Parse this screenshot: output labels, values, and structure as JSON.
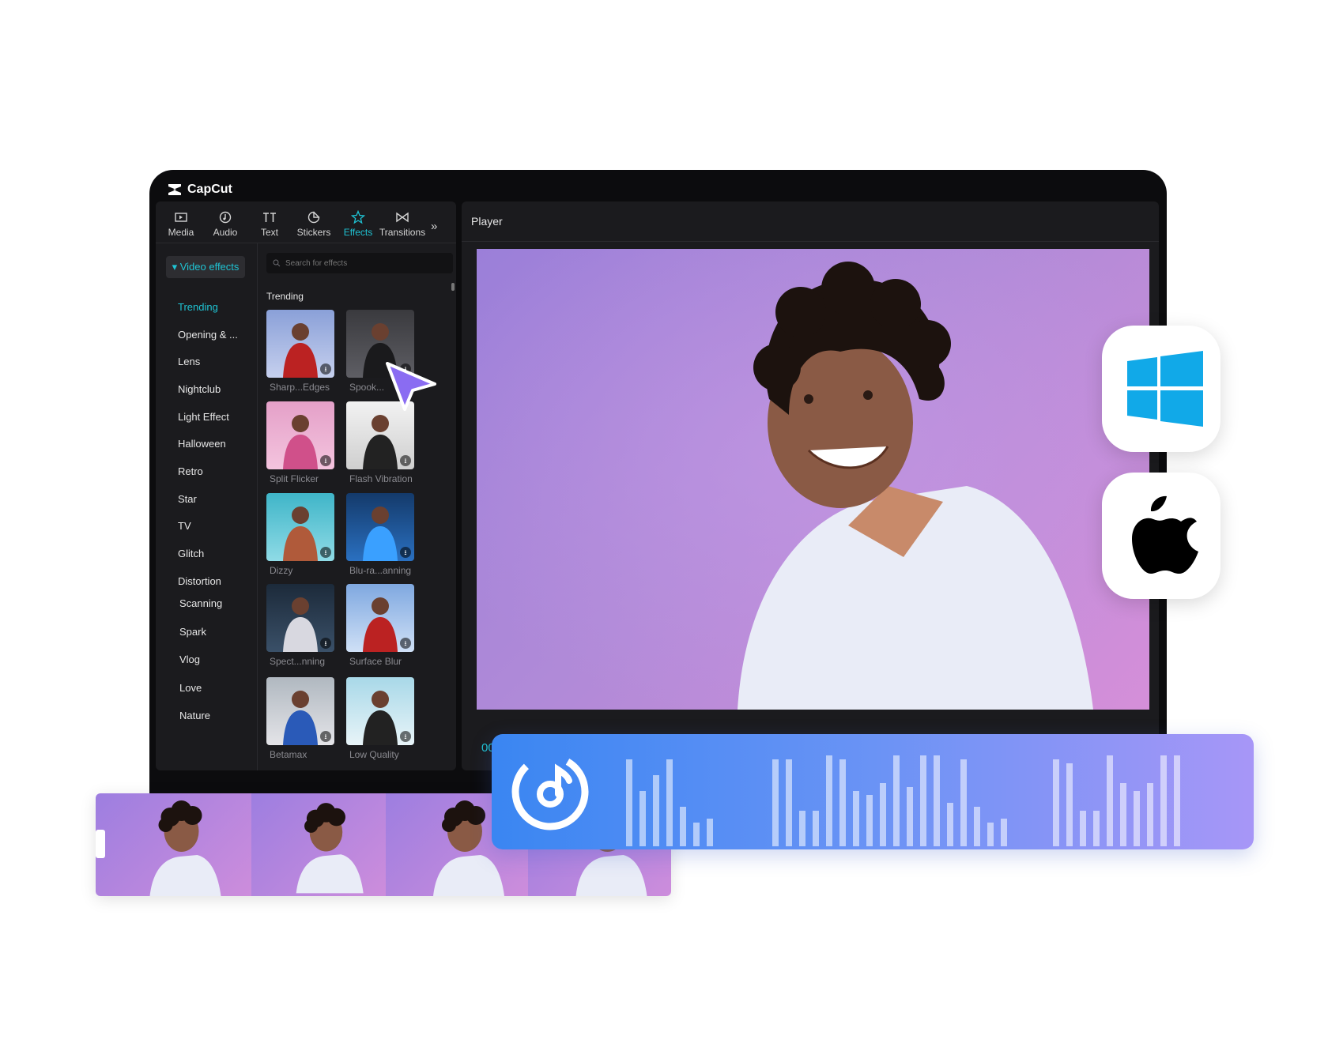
{
  "app": {
    "brand": "CapCut"
  },
  "toolbar": {
    "tabs": [
      {
        "label": "Media",
        "icon": "media-icon"
      },
      {
        "label": "Audio",
        "icon": "audio-icon"
      },
      {
        "label": "Text",
        "icon": "text-icon"
      },
      {
        "label": "Stickers",
        "icon": "stickers-icon"
      },
      {
        "label": "Effects",
        "icon": "effects-icon",
        "active": true
      },
      {
        "label": "Transitions",
        "icon": "transitions-icon"
      }
    ],
    "more": "»"
  },
  "effects_panel": {
    "section": "▾ Video effects",
    "categories": [
      "Trending",
      "Opening & ...",
      "Lens",
      "Nightclub",
      "Light Effect",
      "Halloween",
      "Retro",
      "Star",
      "TV",
      "Glitch",
      "Distortion",
      "Scanning",
      "Spark",
      "Vlog",
      "Love",
      "Nature"
    ],
    "active_category": "Trending",
    "search_placeholder": "Search for effects",
    "grid_title": "Trending",
    "items": [
      "Sharp...Edges",
      "Spook...",
      "Split Flicker",
      "Flash Vibration",
      "Dizzy",
      "Blu-ra...anning",
      "Spect...nning",
      "Surface Blur",
      "Betamax",
      "Low Quality"
    ]
  },
  "player": {
    "title": "Player",
    "time": "00"
  },
  "platforms": [
    "windows-logo",
    "apple-logo"
  ],
  "colors": {
    "accent": "#1fc3d3",
    "panel": "#1b1b1e",
    "audio_start": "#3a86f2",
    "audio_end": "#a796f7"
  }
}
